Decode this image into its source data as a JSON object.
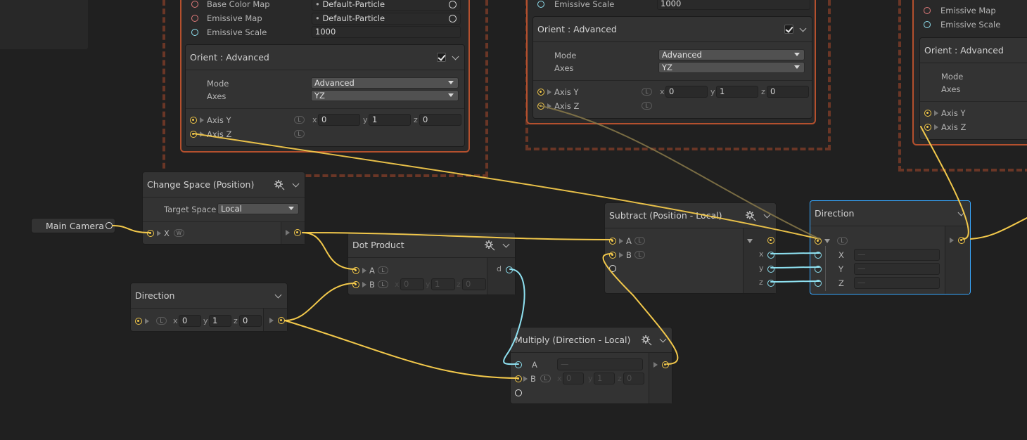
{
  "context_left": {
    "rows": [
      {
        "label": "Base Color Map",
        "value": "Default-Particle"
      },
      {
        "label": "Emissive Map",
        "value": "Default-Particle"
      },
      {
        "label": "Emissive Scale",
        "value": "1000"
      }
    ],
    "orient": {
      "title": "Orient : Advanced",
      "mode_label": "Mode",
      "mode_value": "Advanced",
      "axes_label": "Axes",
      "axes_value": "YZ",
      "axis_y_label": "Axis Y",
      "axis_z_label": "Axis Z",
      "x_label": "x",
      "y_label": "y",
      "z_label": "z",
      "x_value": "0",
      "y_value": "1",
      "z_value": "0",
      "space_badge": "L"
    }
  },
  "context_mid": {
    "emissive_scale_label": "Emissive Scale",
    "emissive_scale_value": "1000",
    "orient": {
      "title": "Orient : Advanced",
      "mode_label": "Mode",
      "mode_value": "Advanced",
      "axes_label": "Axes",
      "axes_value": "YZ",
      "axis_y_label": "Axis Y",
      "axis_z_label": "Axis Z",
      "x_label": "x",
      "y_label": "y",
      "z_label": "z",
      "x_value": "0",
      "y_value": "1",
      "z_value": "0",
      "space_badge": "L"
    }
  },
  "context_right": {
    "rows": [
      {
        "label": "Emissive Map"
      },
      {
        "label": "Emissive Scale"
      }
    ],
    "orient": {
      "title": "Orient : Advanced",
      "mode_label": "Mode",
      "axes_label": "Axes",
      "axis_y_label": "Axis Y",
      "axis_z_label": "Axis Z"
    }
  },
  "main_camera": {
    "label": "Main Camera"
  },
  "change_space": {
    "title": "Change Space (Position)",
    "target_space_label": "Target Space",
    "target_space_value": "Local",
    "input_label": "X",
    "world_badge": "W"
  },
  "dot_product": {
    "title": "Dot Product",
    "a_label": "A",
    "b_label": "B",
    "out_label": "d",
    "space_badge": "L",
    "x_label": "x",
    "y_label": "y",
    "z_label": "z",
    "x_value": "0",
    "y_value": "1",
    "z_value": "0"
  },
  "direction_left": {
    "title": "Direction",
    "space_badge": "L",
    "x_label": "x",
    "y_label": "y",
    "z_label": "z",
    "x_value": "0",
    "y_value": "1",
    "z_value": "0"
  },
  "multiply": {
    "title": "Multiply (Direction - Local)",
    "a_label": "A",
    "a_value": "—",
    "b_label": "B",
    "space_badge": "L",
    "x_label": "x",
    "y_label": "y",
    "z_label": "z",
    "x_value": "0",
    "y_value": "1",
    "z_value": "0"
  },
  "subtract": {
    "title": "Subtract (Position - Local)",
    "a_label": "A",
    "b_label": "B",
    "space_badge": "L",
    "out_x": "x",
    "out_y": "y",
    "out_z": "z"
  },
  "direction_right": {
    "title": "Direction",
    "space_badge": "L",
    "x_label": "X",
    "y_label": "Y",
    "z_label": "Z",
    "x_value": "—",
    "y_value": "—",
    "z_value": "—"
  },
  "colors": {
    "background": "#202020",
    "wire_float3": "#f2c84b",
    "wire_float": "#8ee0f0",
    "context_border": "#b4502e",
    "selection": "#38a8ff"
  }
}
